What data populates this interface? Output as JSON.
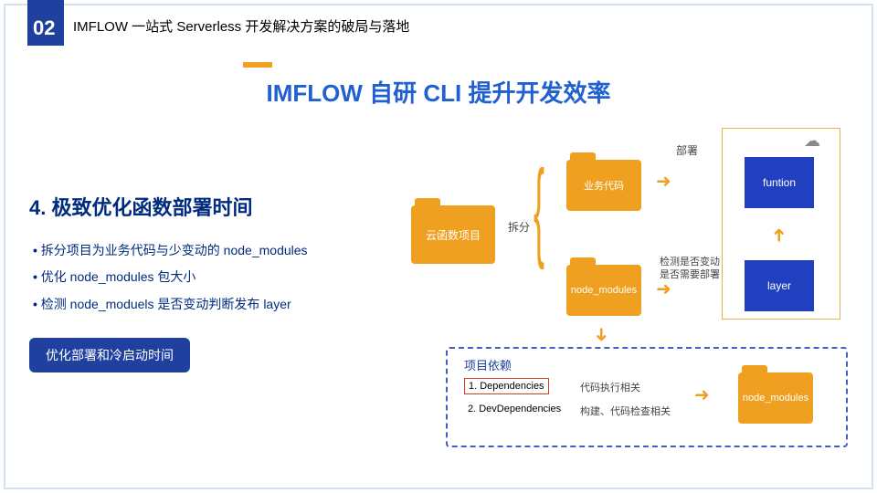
{
  "page": {
    "number": "02",
    "breadcrumb": "IMFLOW 一站式 Serverless 开发解决方案的破局与落地"
  },
  "title": "IMFLOW 自研 CLI 提升开发效率",
  "subtitle": "4. 极致优化函数部署时间",
  "bullets": [
    "拆分项目为业务代码与少变动的 node_modules",
    "优化 node_modules 包大小",
    "检测 node_moduels 是否变动判断发布 layer"
  ],
  "badge": "优化部署和冷启动时间",
  "diagram": {
    "folder_main": "云函数项目",
    "folder_biz": "业务代码",
    "folder_nm1": "node_modules",
    "folder_nm2": "node_modules",
    "box_func": "funtion",
    "box_layer": "layer",
    "lbl_split": "拆分",
    "lbl_deploy": "部署",
    "lbl_detect1": "检测是否变动",
    "lbl_detect2": "是否需要部署",
    "deps_title": "项目依赖",
    "dep1": "1. Dependencies",
    "dep2": "2. DevDependencies",
    "dep1_note": "代码执行相关",
    "dep2_note": "构建、代码检查相关"
  }
}
